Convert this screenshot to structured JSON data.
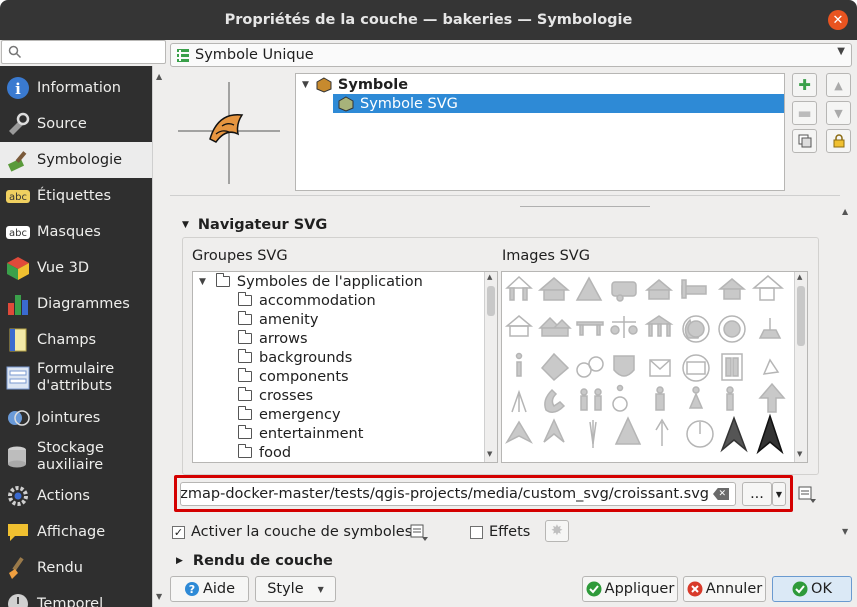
{
  "window": {
    "title": "Propriétés de la couche — bakeries — Symbologie"
  },
  "search": {
    "placeholder": ""
  },
  "sidebar": {
    "items": [
      {
        "label": "Information",
        "icon": "info-icon"
      },
      {
        "label": "Source",
        "icon": "source-icon"
      },
      {
        "label": "Symbologie",
        "icon": "paintbrush-icon"
      },
      {
        "label": "Étiquettes",
        "icon": "abc-labels-icon"
      },
      {
        "label": "Masques",
        "icon": "abc-masks-icon"
      },
      {
        "label": "Vue 3D",
        "icon": "cube-3d-icon"
      },
      {
        "label": "Diagrammes",
        "icon": "diagram-icon"
      },
      {
        "label": "Champs",
        "icon": "fields-icon"
      },
      {
        "label": "Formulaire d'attributs",
        "icon": "form-icon"
      },
      {
        "label": "Jointures",
        "icon": "joins-icon"
      },
      {
        "label": "Stockage auxiliaire",
        "icon": "database-icon"
      },
      {
        "label": "Actions",
        "icon": "gear-icon"
      },
      {
        "label": "Affichage",
        "icon": "speech-bubble-icon"
      },
      {
        "label": "Rendu",
        "icon": "brush-icon"
      },
      {
        "label": "Temporel",
        "icon": "clock-icon"
      }
    ]
  },
  "renderer": {
    "selected": "Symbole Unique"
  },
  "symbol_tree": {
    "root": "Symbole",
    "child": "Symbole SVG"
  },
  "svg_browser": {
    "title": "Navigateur SVG",
    "groups_label": "Groupes SVG",
    "images_label": "Images SVG",
    "root_group": "Symboles de l'application",
    "groups": [
      "accommodation",
      "amenity",
      "arrows",
      "backgrounds",
      "components",
      "crosses",
      "emergency",
      "entertainment",
      "food"
    ]
  },
  "path": {
    "value": "ap/lizmap-docker-master/tests/qgis-projects/media/custom_svg/croissant.svg",
    "browse_label": "..."
  },
  "options": {
    "enable_symbol_layer": "Activer la couche de symboles",
    "effects": "Effets"
  },
  "layer_rendering": {
    "title": "Rendu de couche"
  },
  "footer": {
    "help": "Aide",
    "style": "Style",
    "apply": "Appliquer",
    "cancel": "Annuler",
    "ok": "OK"
  },
  "colors": {
    "accent": "#2e8ad6",
    "highlight": "#d40000",
    "titlebar": "#353535",
    "sidebar": "#2f2f2f"
  }
}
